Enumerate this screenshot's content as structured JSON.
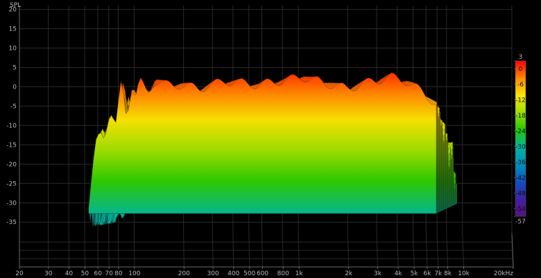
{
  "chart_data": {
    "type": "area",
    "subtype": "waterfall-3d",
    "ylabel": "SPL",
    "ylim": [
      -38,
      21
    ],
    "y_ticks": [
      "20",
      "15",
      "10",
      "5",
      "0",
      "-5",
      "-10",
      "-15",
      "-20",
      "-25",
      "-30",
      "-35"
    ],
    "y_tick_values": [
      20,
      15,
      10,
      5,
      0,
      -5,
      -10,
      -15,
      -20,
      -25,
      -30,
      -35
    ],
    "x_scale": "log",
    "xlim": [
      20,
      20000
    ],
    "x_ticks": [
      "20",
      "30",
      "40",
      "50",
      "60",
      "70",
      "80",
      "100",
      "200",
      "300",
      "400",
      "500",
      "600",
      "800",
      "1k",
      "2k",
      "3k",
      "4k",
      "5k",
      "6k",
      "7k",
      "8k",
      "10k",
      "20kHz"
    ],
    "x_tick_values": [
      20,
      30,
      40,
      50,
      60,
      70,
      80,
      100,
      200,
      300,
      400,
      500,
      600,
      800,
      1000,
      2000,
      3000,
      4000,
      5000,
      6000,
      7000,
      8000,
      10000,
      20000
    ],
    "colorbar": {
      "range": [
        -57,
        3
      ],
      "ticks": [
        "3",
        "0",
        "-6",
        "-12",
        "-18",
        "-24",
        "-30",
        "-36",
        "-42",
        "-48",
        "-54",
        "-57"
      ],
      "tick_values": [
        3,
        0,
        -6,
        -12,
        -18,
        -24,
        -30,
        -36,
        -42,
        -48,
        -54,
        -57
      ]
    },
    "series_front": {
      "name": "",
      "x": [
        36,
        40,
        43,
        46,
        50,
        55,
        60,
        65,
        70,
        75,
        80,
        90,
        100,
        120,
        150,
        200,
        300,
        500,
        1000,
        2000,
        3000,
        4000,
        5000,
        6000,
        7000,
        8000
      ],
      "y": [
        -30,
        -12,
        -8,
        -10,
        -5,
        -8,
        5,
        -5,
        2,
        0,
        4,
        1,
        4,
        3,
        3,
        2,
        4,
        3,
        5,
        2,
        4,
        5,
        4,
        2,
        0,
        -2
      ]
    },
    "colors": [
      "#ff0000",
      "#ff8a00",
      "#ffe600",
      "#9be000",
      "#22c800",
      "#00b4a0",
      "#0090c0",
      "#1050c0",
      "#4020a0",
      "#5a1080"
    ]
  }
}
